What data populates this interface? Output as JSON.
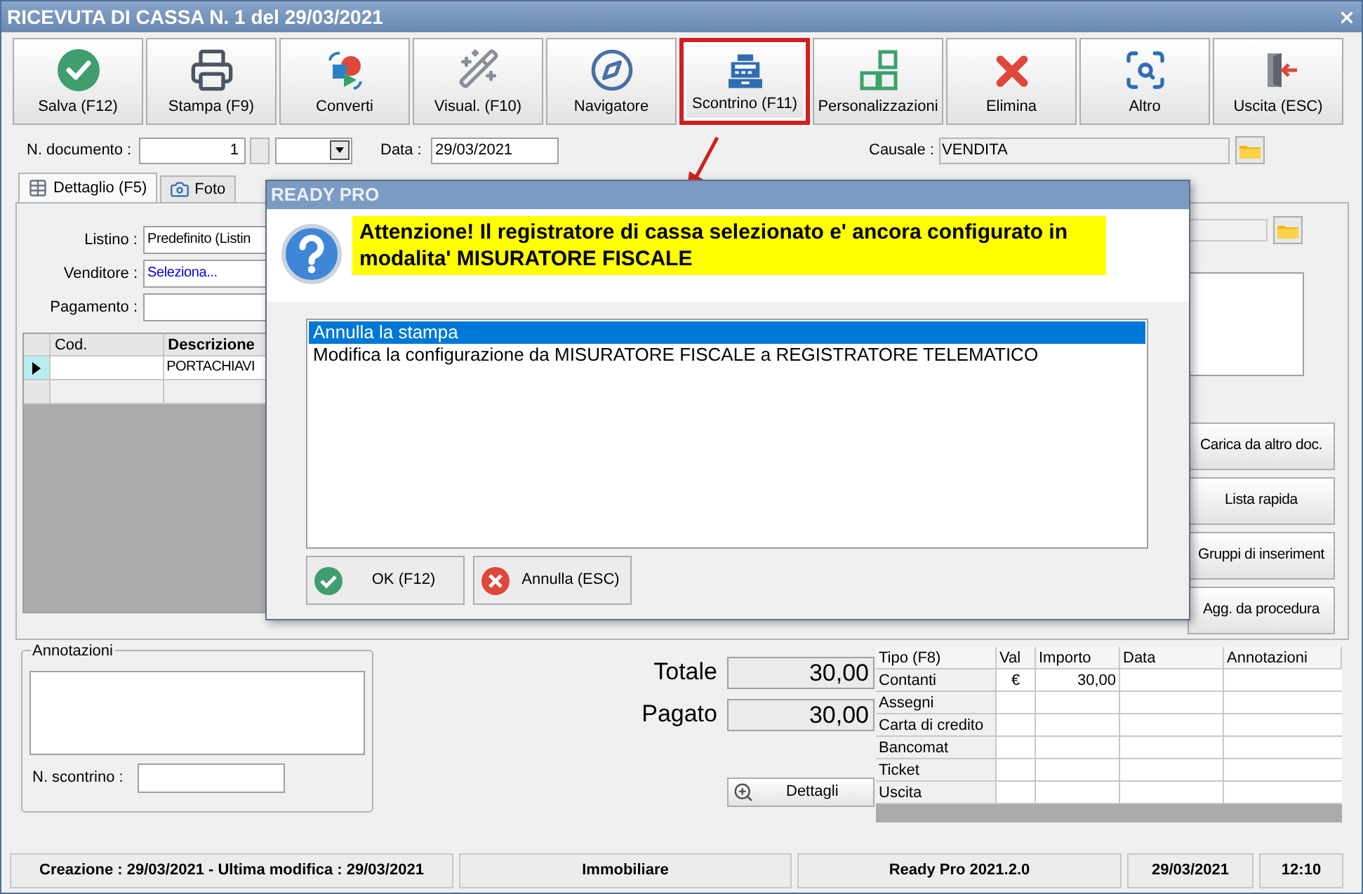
{
  "window": {
    "title": "RICEVUTA DI CASSA N. 1 del 29/03/2021"
  },
  "toolbar": [
    {
      "label": "Salva (F12)",
      "kind": "check",
      "highlighted": false
    },
    {
      "label": "Stampa (F9)",
      "kind": "printer",
      "highlighted": false
    },
    {
      "label": "Converti",
      "kind": "convert",
      "highlighted": false
    },
    {
      "label": "Visual. (F10)",
      "kind": "wand",
      "highlighted": false
    },
    {
      "label": "Navigatore",
      "kind": "compass",
      "highlighted": false
    },
    {
      "label": "Scontrino (F11)",
      "kind": "register",
      "highlighted": true
    },
    {
      "label": "Personalizzazioni",
      "kind": "grid",
      "highlighted": false
    },
    {
      "label": "Elimina",
      "kind": "delete",
      "highlighted": false
    },
    {
      "label": "Altro",
      "kind": "search",
      "highlighted": false
    },
    {
      "label": "Uscita (ESC)",
      "kind": "exit",
      "highlighted": false
    }
  ],
  "header": {
    "doc_number_label": "N. documento :",
    "doc_number": "1",
    "date_label": "Data :",
    "date": "29/03/2021",
    "causale_label": "Causale :",
    "causale": "VENDITA"
  },
  "tabs": [
    {
      "label": "Dettaglio (F5)",
      "kind": "table",
      "selected": true
    },
    {
      "label": "Foto",
      "kind": "camera",
      "selected": false
    }
  ],
  "form": [
    {
      "label": "Listino :",
      "value": "Predefinito (Listin",
      "kind": "text"
    },
    {
      "label": "Venditore :",
      "value": "Seleziona...",
      "kind": "prompt"
    },
    {
      "label": "Pagamento :",
      "kind": "text"
    }
  ],
  "grid": {
    "columns": [
      "Cod.",
      "Descrizione"
    ],
    "rows": [
      {
        "current": true,
        "descrizione": "PORTACHIAVI"
      },
      {
        "current": false
      }
    ]
  },
  "side_buttons": [
    "Carica da altro doc.",
    "Lista rapida",
    "Gruppi di inseriment",
    "Agg. da procedura"
  ],
  "annotations": {
    "title": "Annotazioni",
    "receipt_label": "N. scontrino :"
  },
  "totals": [
    {
      "label": "Totale",
      "value": "30,00"
    },
    {
      "label": "Pagato",
      "value": "30,00"
    }
  ],
  "details_button": "Dettagli",
  "payments": {
    "columns": [
      "Tipo (F8)",
      "Val",
      "Importo",
      "Data",
      "Annotazioni"
    ],
    "rows": [
      {
        "type": "Contanti",
        "currency": "€",
        "amount": "30,00"
      },
      {
        "type": "Assegni"
      },
      {
        "type": "Carta di credito"
      },
      {
        "type": "Bancomat"
      },
      {
        "type": "Ticket"
      },
      {
        "type": "Uscita"
      }
    ]
  },
  "status_bar": [
    "Creazione : 29/03/2021 - Ultima modifica : 29/03/2021",
    "Immobiliare",
    "Ready Pro 2021.2.0",
    "29/03/2021",
    "12:10"
  ],
  "dialog": {
    "title": "READY PRO",
    "message": "Attenzione! Il registratore di cassa selezionato e' ancora configurato in modalita' MISURATORE FISCALE",
    "options": [
      {
        "label": "Annulla la stampa",
        "selected": true
      },
      {
        "label": "Modifica la configurazione da MISURATORE FISCALE a REGISTRATORE TELEMATICO",
        "selected": false
      }
    ],
    "buttons": [
      {
        "label": "OK (F12)",
        "kind": "ok"
      },
      {
        "label": "Annulla (ESC)",
        "kind": "cancel"
      }
    ]
  }
}
